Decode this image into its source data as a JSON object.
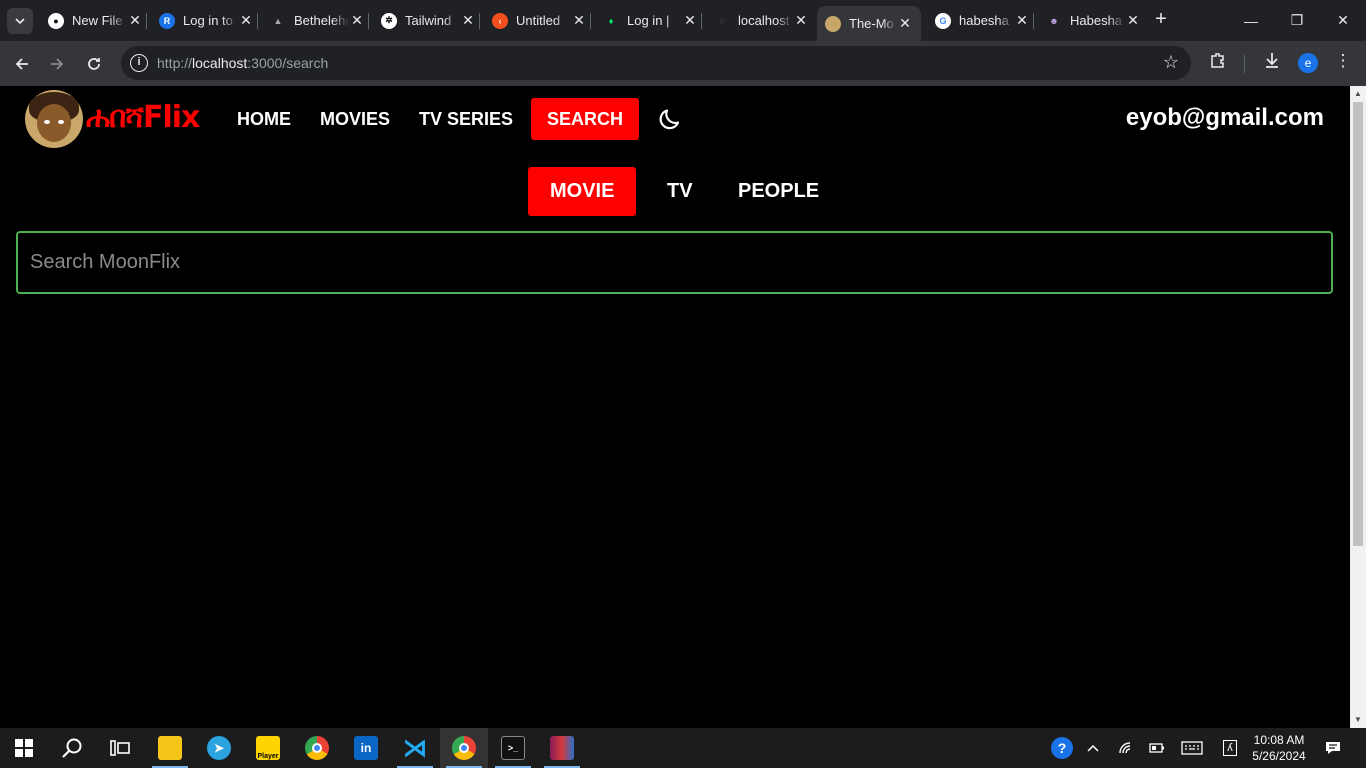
{
  "browser": {
    "tabs": [
      {
        "title": "New File",
        "favicon": "github-icon",
        "color": "#ffffff"
      },
      {
        "title": "Log in to",
        "favicon": "replit-icon",
        "color": "#1a73e8"
      },
      {
        "title": "Bethelehem",
        "favicon": "bethel-icon",
        "color": "#888888"
      },
      {
        "title": "Tailwind",
        "favicon": "openai-icon",
        "color": "#ffffff"
      },
      {
        "title": "Untitled",
        "favicon": "figma-icon",
        "color": "#f24e1e"
      },
      {
        "title": "Log in |",
        "favicon": "mongodb-icon",
        "color": "#00ed64"
      },
      {
        "title": "localhost",
        "favicon": "localhost-icon",
        "color": "#888888"
      },
      {
        "title": "The-Mo",
        "favicon": "moonflix-icon",
        "color": "#c9a76a"
      },
      {
        "title": "habesha",
        "favicon": "google-icon",
        "color": "#4285f4"
      },
      {
        "title": "Habesha",
        "favicon": "ai-icon",
        "color": "#b9a0e0"
      }
    ],
    "url_host": "localhost",
    "url_prefix": "http://",
    "url_rest": ":3000/search",
    "profile_initial": "e"
  },
  "site": {
    "brand": "ሐበሻFlix",
    "nav": [
      {
        "label": "HOME"
      },
      {
        "label": "MOVIES"
      },
      {
        "label": "TV SERIES"
      },
      {
        "label": "SEARCH"
      }
    ],
    "active_nav": "SEARCH",
    "user_email": "eyob@gmail.com"
  },
  "search": {
    "tabs": [
      {
        "label": "MOVIE"
      },
      {
        "label": "TV"
      },
      {
        "label": "PEOPLE"
      }
    ],
    "active_tab": "MOVIE",
    "placeholder": "Search MoonFlix",
    "value": ""
  },
  "taskbar": {
    "time": "10:08 AM",
    "date": "5/26/2024",
    "player_label": "Player"
  }
}
